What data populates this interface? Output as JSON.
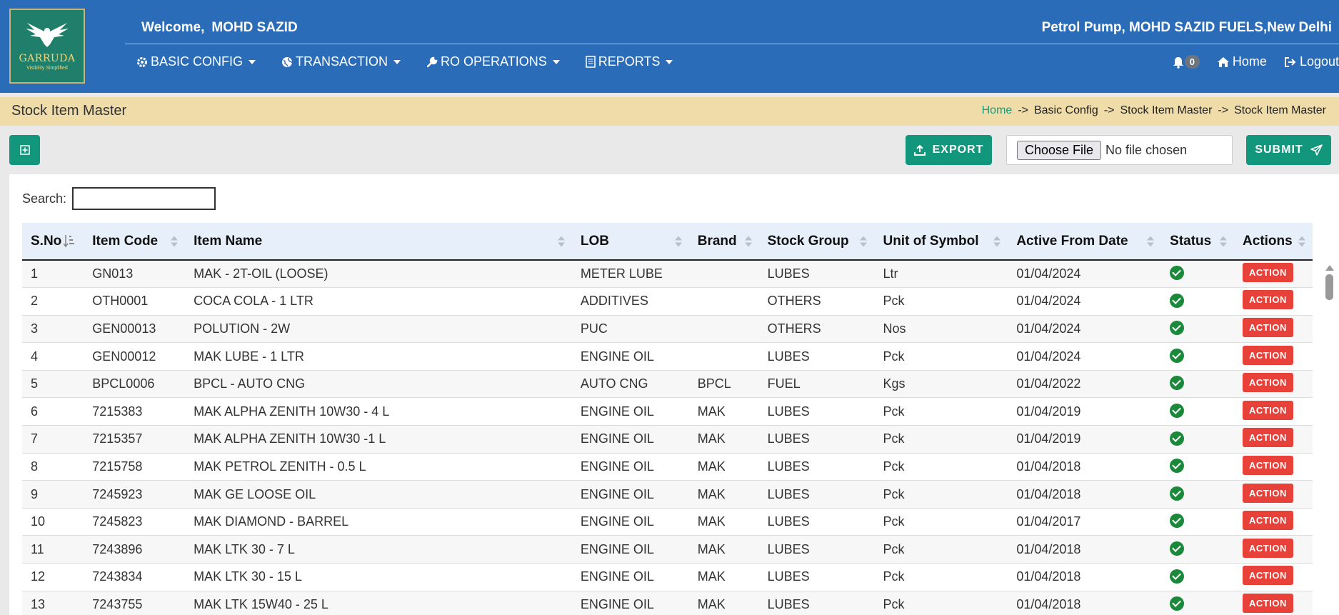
{
  "header": {
    "logo_brand": "GARRUDA",
    "logo_tagline": "Visibility Simplified",
    "welcome_label": "Welcome,",
    "user_name": "MOHD SAZID",
    "station": "Petrol Pump, MOHD SAZID FUELS,New Delhi",
    "nav": [
      {
        "label": "BASIC CONFIG",
        "icon": "gear-icon"
      },
      {
        "label": "TRANSACTION",
        "icon": "globe-icon"
      },
      {
        "label": "RO OPERATIONS",
        "icon": "wrench-icon"
      },
      {
        "label": "REPORTS",
        "icon": "document-icon"
      }
    ],
    "notification_count": "0",
    "home_label": "Home",
    "logout_label": "Logout"
  },
  "page": {
    "title": "Stock Item Master",
    "breadcrumb": [
      "Home",
      "Basic Config",
      "Stock Item Master",
      "Stock Item Master"
    ],
    "breadcrumb_sep": "->"
  },
  "toolbar": {
    "export_label": "EXPORT",
    "file_button_label": "Choose File",
    "file_status": "No file chosen",
    "submit_label": "SUBMIT"
  },
  "search": {
    "label": "Search:",
    "value": ""
  },
  "table": {
    "columns": [
      "S.No",
      "Item Code",
      "Item Name",
      "LOB",
      "Brand",
      "Stock Group",
      "Unit of Symbol",
      "Active From Date",
      "Status",
      "Actions"
    ],
    "action_label": "ACTION",
    "rows": [
      [
        "1",
        "GN013",
        "MAK - 2T-OIL (LOOSE)",
        "METER LUBE",
        "",
        "LUBES",
        "Ltr",
        "01/04/2024"
      ],
      [
        "2",
        "OTH0001",
        "COCA COLA - 1 LTR",
        "ADDITIVES",
        "",
        "OTHERS",
        "Pck",
        "01/04/2024"
      ],
      [
        "3",
        "GEN00013",
        "POLUTION - 2W",
        "PUC",
        "",
        "OTHERS",
        "Nos",
        "01/04/2024"
      ],
      [
        "4",
        "GEN00012",
        "MAK LUBE - 1 LTR",
        "ENGINE OIL",
        "",
        "LUBES",
        "Pck",
        "01/04/2024"
      ],
      [
        "5",
        "BPCL0006",
        "BPCL - AUTO CNG",
        "AUTO CNG",
        "BPCL",
        "FUEL",
        "Kgs",
        "01/04/2022"
      ],
      [
        "6",
        "7215383",
        "MAK ALPHA ZENITH 10W30 - 4 L",
        "ENGINE OIL",
        "MAK",
        "LUBES",
        "Pck",
        "01/04/2019"
      ],
      [
        "7",
        "7215357",
        "MAK ALPHA ZENITH 10W30 -1 L",
        "ENGINE OIL",
        "MAK",
        "LUBES",
        "Pck",
        "01/04/2019"
      ],
      [
        "8",
        "7215758",
        "MAK PETROL ZENITH - 0.5 L",
        "ENGINE OIL",
        "MAK",
        "LUBES",
        "Pck",
        "01/04/2018"
      ],
      [
        "9",
        "7245923",
        "MAK GE LOOSE OIL",
        "ENGINE OIL",
        "MAK",
        "LUBES",
        "Pck",
        "01/04/2018"
      ],
      [
        "10",
        "7245823",
        "MAK DIAMOND - BARREL",
        "ENGINE OIL",
        "MAK",
        "LUBES",
        "Pck",
        "01/04/2017"
      ],
      [
        "11",
        "7243896",
        "MAK LTK 30 - 7 L",
        "ENGINE OIL",
        "MAK",
        "LUBES",
        "Pck",
        "01/04/2018"
      ],
      [
        "12",
        "7243834",
        "MAK LTK 30 - 15 L",
        "ENGINE OIL",
        "MAK",
        "LUBES",
        "Pck",
        "01/04/2018"
      ],
      [
        "13",
        "7243755",
        "MAK LTK 15W40 - 25 L",
        "ENGINE OIL",
        "MAK",
        "LUBES",
        "Pck",
        "01/04/2018"
      ]
    ]
  },
  "colors": {
    "header_bg": "#2b6cb8",
    "titlebar_bg": "#efdca8",
    "primary_button": "#12977d",
    "action_button": "#e8413a",
    "status_active": "#1a8a3a"
  }
}
